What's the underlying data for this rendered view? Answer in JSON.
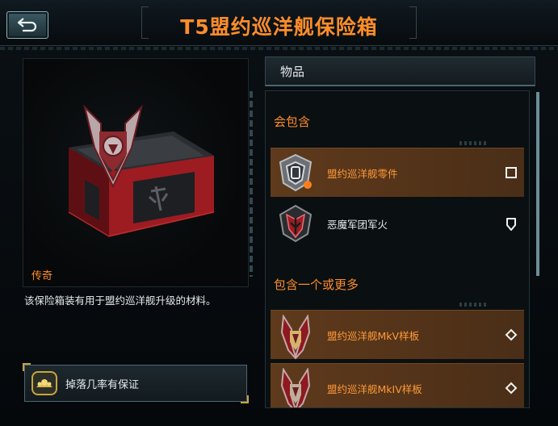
{
  "header": {
    "title": "T5盟约巡洋舰保险箱",
    "back_icon": "back-arrow-icon"
  },
  "item": {
    "rarity": "传奇",
    "description": "该保险箱装有用于盟约巡洋舰升级的材料。",
    "image_icon": "red-crate-icon"
  },
  "drop": {
    "label": "掉落几率有保证",
    "icon": "guarantee-badge-icon"
  },
  "panel": {
    "tab_label": "物品",
    "sections": [
      {
        "title": "会包含",
        "items": [
          {
            "label": "盟约巡洋舰零件",
            "icon": "cruiser-part-icon",
            "marker": "square",
            "highlight": true
          },
          {
            "label": "恶魔军团军火",
            "icon": "demon-legion-icon",
            "marker": "shield",
            "highlight": false
          }
        ]
      },
      {
        "title": "包含一个或更多",
        "items": [
          {
            "label": "盟约巡洋舰MkV样板",
            "icon": "cruiser-template-icon",
            "marker": "diamond",
            "highlight": true
          },
          {
            "label": "盟约巡洋舰MkIV样板",
            "icon": "cruiser-template-icon",
            "marker": "diamond",
            "highlight": true
          }
        ]
      }
    ]
  },
  "colors": {
    "accent": "#ff8d2a",
    "row_highlight": "#5f3a1c",
    "text": "#e6eaec"
  }
}
